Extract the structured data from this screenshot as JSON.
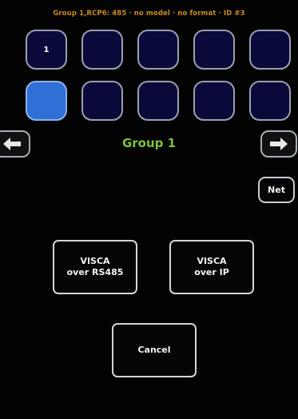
{
  "header": {
    "status": "Group 1,RCP6: 485 · no model · no format · ID #3"
  },
  "slots": [
    {
      "label": "1",
      "selected": false
    },
    {
      "label": "",
      "selected": false
    },
    {
      "label": "",
      "selected": false
    },
    {
      "label": "",
      "selected": false
    },
    {
      "label": "",
      "selected": false
    },
    {
      "label": "",
      "selected": true
    },
    {
      "label": "",
      "selected": false
    },
    {
      "label": "",
      "selected": false
    },
    {
      "label": "",
      "selected": false
    },
    {
      "label": "",
      "selected": false
    }
  ],
  "nav": {
    "prev_icon": "arrow-left-icon",
    "next_icon": "arrow-right-icon",
    "group_name": "Group 1",
    "net_label": "Net"
  },
  "protocol": {
    "rs485_line1": "VISCA",
    "rs485_line2": "over RS485",
    "ip_line1": "VISCA",
    "ip_line2": "over IP"
  },
  "cancel_label": "Cancel",
  "colors": {
    "header": "#c98a1e",
    "group_name": "#7fc13a",
    "selected_slot": "#2f6fd6",
    "slot_fill": "#0a0a3a"
  }
}
